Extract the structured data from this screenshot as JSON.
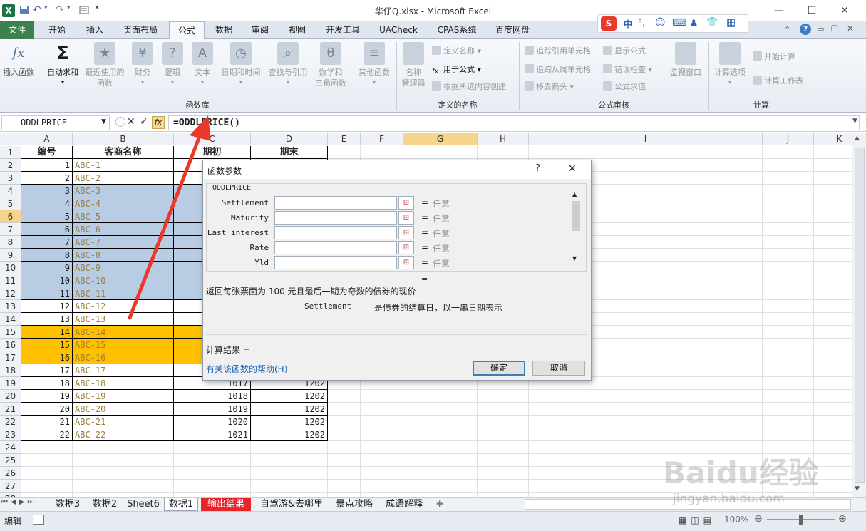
{
  "window": {
    "title": "华仔Q.xlsx - Microsoft Excel",
    "minimize": "—",
    "maximize": "☐",
    "close": "✕"
  },
  "qat": {
    "app_icon": "X"
  },
  "sogou": {
    "logo": "S",
    "items": [
      "中",
      "°,",
      "☺",
      "⌨",
      "♟",
      "👕",
      "▦"
    ]
  },
  "tabs": [
    "文件",
    "开始",
    "插入",
    "页面布局",
    "公式",
    "数据",
    "审阅",
    "视图",
    "开发工具",
    "UACheck",
    "CPAS系统",
    "百度网盘"
  ],
  "active_tab": "公式",
  "ribbon": {
    "library": {
      "label": "函数库",
      "buttons": [
        {
          "label": "插入函数",
          "icon": "fx"
        },
        {
          "label": "自动求和",
          "icon": "Σ"
        },
        {
          "label": "最近使用的\n函数",
          "icon": "★"
        },
        {
          "label": "财务",
          "icon": "¥"
        },
        {
          "label": "逻辑",
          "icon": "?"
        },
        {
          "label": "文本",
          "icon": "A"
        },
        {
          "label": "日期和时间",
          "icon": "◷"
        },
        {
          "label": "查找与引用",
          "icon": "⌕"
        },
        {
          "label": "数学和\n三角函数",
          "icon": "θ"
        },
        {
          "label": "其他函数",
          "icon": "≡"
        }
      ]
    },
    "names": {
      "label": "定义的名称",
      "manager": "名称\n管理器",
      "items": [
        "定义名称 ▾",
        "用于公式 ▾",
        "根据所选内容创建"
      ]
    },
    "audit": {
      "label": "公式审核",
      "left": [
        "追踪引用单元格",
        "追踪从属单元格",
        "移去箭头 ▾"
      ],
      "right": [
        "显示公式",
        "错误检查 ▾",
        "公式求值"
      ],
      "watch": "监视窗口"
    },
    "calc": {
      "label": "计算",
      "options": "计算选项",
      "items": [
        "开始计算",
        "计算工作表"
      ]
    }
  },
  "formula_bar": {
    "name_box": "ODDLPRICE",
    "formula": "=ODDLPRICE()",
    "fx": "fx",
    "cancel": "✕",
    "enter": "✓"
  },
  "columns": [
    "A",
    "B",
    "C",
    "D",
    "E",
    "F",
    "G",
    "H",
    "I",
    "J",
    "K"
  ],
  "headers": {
    "a": "编号",
    "b": "客商名称",
    "c": "期初",
    "d": "期末"
  },
  "rows": [
    {
      "n": "1",
      "b": "ABC-1",
      "c": "",
      "d": ""
    },
    {
      "n": "2",
      "b": "ABC-2",
      "c": "",
      "d": ""
    },
    {
      "n": "3",
      "b": "ABC-3",
      "c": "",
      "d": ""
    },
    {
      "n": "4",
      "b": "ABC-4",
      "c": "",
      "d": ""
    },
    {
      "n": "5",
      "b": "ABC-5",
      "c": "",
      "d": ""
    },
    {
      "n": "6",
      "b": "ABC-6",
      "c": "",
      "d": ""
    },
    {
      "n": "7",
      "b": "ABC-7",
      "c": "",
      "d": ""
    },
    {
      "n": "8",
      "b": "ABC-8",
      "c": "",
      "d": ""
    },
    {
      "n": "9",
      "b": "ABC-9",
      "c": "",
      "d": ""
    },
    {
      "n": "10",
      "b": "ABC-10",
      "c": "",
      "d": ""
    },
    {
      "n": "11",
      "b": "ABC-11",
      "c": "",
      "d": ""
    },
    {
      "n": "12",
      "b": "ABC-12",
      "c": "",
      "d": ""
    },
    {
      "n": "13",
      "b": "ABC-13",
      "c": "",
      "d": ""
    },
    {
      "n": "14",
      "b": "ABC-14",
      "c": "",
      "d": ""
    },
    {
      "n": "15",
      "b": "ABC-15",
      "c": "",
      "d": ""
    },
    {
      "n": "16",
      "b": "ABC-16",
      "c": "",
      "d": ""
    },
    {
      "n": "17",
      "b": "ABC-17",
      "c": "",
      "d": ""
    },
    {
      "n": "18",
      "b": "ABC-18",
      "c": "1017",
      "d": "1202"
    },
    {
      "n": "19",
      "b": "ABC-19",
      "c": "1018",
      "d": "1202"
    },
    {
      "n": "20",
      "b": "ABC-20",
      "c": "1019",
      "d": "1202"
    },
    {
      "n": "21",
      "b": "ABC-21",
      "c": "1020",
      "d": "1202"
    },
    {
      "n": "22",
      "b": "ABC-22",
      "c": "1021",
      "d": "1202"
    }
  ],
  "row_fill": {
    "blue": "#b8cce4",
    "orange": "#ffc000"
  },
  "dialog": {
    "title": "函数参数",
    "help_btn": "?",
    "close_btn": "✕",
    "func": "ODDLPRICE",
    "args": [
      {
        "label": "Settlement",
        "value": "任意"
      },
      {
        "label": "Maturity",
        "value": "任意"
      },
      {
        "label": "Last_interest",
        "value": "任意"
      },
      {
        "label": "Rate",
        "value": "任意"
      },
      {
        "label": "Yld",
        "value": "任意"
      }
    ],
    "eq": "=",
    "description": "返回每张票面为 100 元且最后一期为奇数的债券的现价",
    "arg_desc_name": "Settlement",
    "arg_desc": "是债券的结算日，以一串日期表示",
    "result_label": "计算结果 =",
    "help_link": "有关该函数的帮助(H)",
    "ok": "确定",
    "cancel": "取消"
  },
  "sheets": [
    "数据3",
    "数据2",
    "Sheet6",
    "数据1",
    "输出结果",
    "自驾游&去哪里",
    "景点攻略",
    "成语解释"
  ],
  "active_sheet": "数据1",
  "status": {
    "mode": "编辑",
    "zoom": "100%"
  },
  "watermark": {
    "line1": "Baidu经验",
    "line2": "jingyan.baidu.com"
  },
  "arrow_color": "#e8392a"
}
